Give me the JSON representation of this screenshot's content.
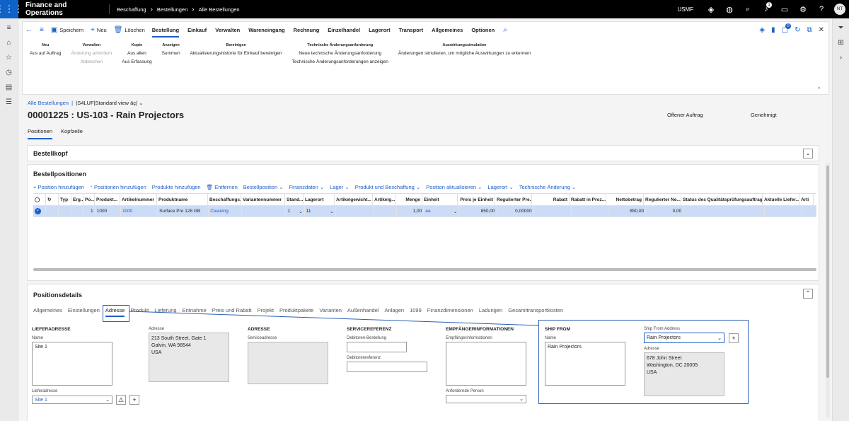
{
  "topbar": {
    "app_title": "Finance and Operations",
    "breadcrumbs": [
      "Beschaffung",
      "Bestellungen",
      "Alle Bestellungen"
    ],
    "company": "USMF",
    "notif_count": "1",
    "avatar_initials": "NT"
  },
  "actions": {
    "save": "Speichern",
    "new": "Neu",
    "delete": "Löschen",
    "tabs": [
      "Bestellung",
      "Einkauf",
      "Verwalten",
      "Wareneingang",
      "Rechnung",
      "Einzelhandel",
      "Lagerort",
      "Transport",
      "Allgemeines",
      "Optionen"
    ],
    "active_tab": "Bestellung",
    "right_badge": "0"
  },
  "groups": [
    {
      "header": "Neu",
      "items": [
        {
          "t": "Aus auf Auftrag",
          "d": false
        }
      ]
    },
    {
      "header": "Verwalten",
      "items": [
        {
          "t": "Änderung anfordern",
          "d": true
        },
        {
          "t": "Abbrechen",
          "d": true
        }
      ]
    },
    {
      "header": "Kopie",
      "items": [
        {
          "t": "Aus allen",
          "d": false
        },
        {
          "t": "Aus Erfassung",
          "d": false
        }
      ]
    },
    {
      "header": "Anzeigen",
      "items": [
        {
          "t": "Summen",
          "d": false
        }
      ]
    },
    {
      "header": "Bereinigen",
      "items": [
        {
          "t": "Aktualisierungshistorie für Einkauf bereinigen",
          "d": false
        }
      ]
    },
    {
      "header": "Technische Änderungsanforderung",
      "items": [
        {
          "t": "Neue technische Änderungsanforderung",
          "d": false
        },
        {
          "t": "Technische Änderungsanforderungen anzeigen",
          "d": false
        }
      ]
    },
    {
      "header": "Auswirkungssimulation",
      "items": [
        {
          "t": "Änderungen simulieren, um mögliche Auswirkungen zu erkennen",
          "d": false
        }
      ]
    }
  ],
  "header": {
    "view_link": "Alle Bestellungen",
    "view_name": "|S4LUF|Standard view äç|",
    "title": "00001225 : US-103 - Rain Projectors",
    "status_a": "Offener Auftrag",
    "status_b": "Genehmigt",
    "page_tabs": [
      "Positionen",
      "Kopfzeile"
    ]
  },
  "bestellkopf": {
    "title": "Bestellkopf"
  },
  "positions": {
    "title": "Bestellpositionen",
    "toolbar": [
      "Position hinzufügen",
      "Positionen hinzufügen",
      "Produkte hinzufügen",
      "Entfernen",
      "Bestellposition",
      "Finanzdaten",
      "Lager",
      "Produkt und Beschaffung",
      "Position aktualisieren",
      "Lagerort",
      "Technische Änderung"
    ],
    "columns": [
      "Typ",
      "Erg...",
      "Po...",
      "Produkt...",
      "Artikelnummer",
      "Produktname",
      "Beschaffungs...",
      "Variantennummer",
      "Stand...",
      "Lagerort",
      "Artikelgewicht...",
      "Artikelg...",
      "Menge",
      "Einheit",
      "Preis je Einheit",
      "Regulierter Pre...",
      "Rabatt",
      "Rabatt in Proz...",
      "Nettobetrag",
      "Regulierter Ne...",
      "Status des Qualitätsprüfungsauftrags",
      "Aktuelle Liefer...",
      "Arti"
    ],
    "row": {
      "pos": "1",
      "prod": "1000",
      "item": "1000",
      "name": "Surface Pro 128 GB",
      "proc": "Cleaning",
      "site": "1",
      "wh": "11",
      "qty": "1,00",
      "unit": "ea",
      "price": "850,00",
      "regprice": "0,00000",
      "net": "850,00",
      "regnet": "0,00"
    }
  },
  "details": {
    "title": "Positionsdetails",
    "tabs": [
      "Allgemeines",
      "Einstellungen",
      "Adresse",
      "Produkt",
      "Lieferung",
      "Entnahme",
      "Preis und Rabatt",
      "Projekt",
      "Produktpakete",
      "Varianten",
      "Außenhandel",
      "Anlagen",
      "1099",
      "Finanzdimensionen",
      "Ladungen",
      "Gesamttransportkosten"
    ],
    "active_tab": "Adresse",
    "lieferadresse": {
      "header": "LIEFERADRESSE",
      "name_label": "Name",
      "name_value": "Site 1",
      "addr_label": "Adresse",
      "addr_lines": [
        "213 South Street, Gate 1",
        "Galvin, WA 98544",
        "USA"
      ],
      "select_label": "Lieferadresse",
      "select_value": "Site 1"
    },
    "adresse": {
      "header": "ADRESSE",
      "label": "Serviceadresse"
    },
    "service": {
      "header": "SERVICEREFERENZ",
      "l1": "Debitoren-Bestellung",
      "l2": "Debitorenreferenz"
    },
    "recipient": {
      "header": "EMPFÄNGERINFORMATIONEN",
      "l1": "Empfängerinformationen",
      "l2": "Anfordernde Person"
    },
    "shipfrom": {
      "header": "SHIP FROM",
      "name_label": "Name",
      "name_value": "Rain Projectors",
      "addr_sel_label": "Ship From Address",
      "addr_sel_value": "Rain Projectors",
      "addr_label": "Adresse",
      "addr_lines": [
        "678 John Street",
        "Washington, DC 20005",
        "USA"
      ]
    }
  }
}
